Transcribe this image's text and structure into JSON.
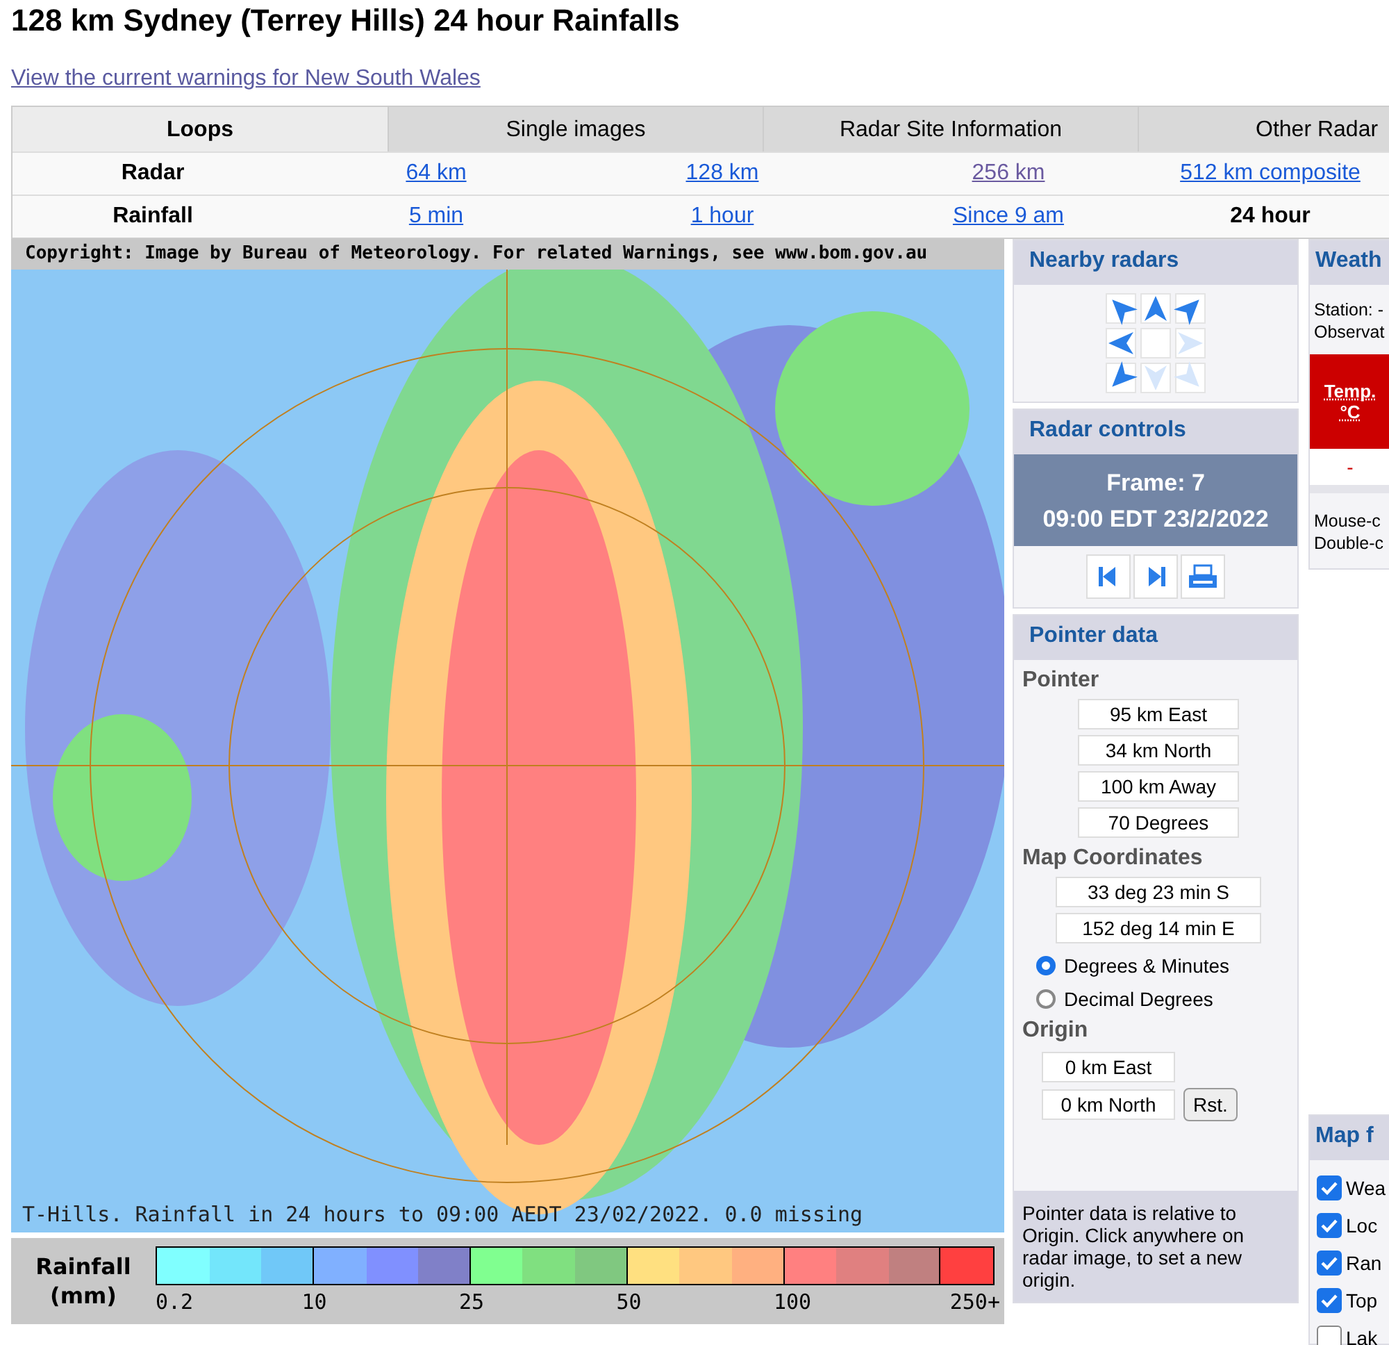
{
  "page_title": "128 km Sydney (Terrey Hills) 24 hour Rainfalls",
  "warnings_link": "View the current warnings for New South Wales",
  "tabs": [
    {
      "label": "Loops",
      "selected": true
    },
    {
      "label": "Single images",
      "selected": false
    },
    {
      "label": "Radar Site Information",
      "selected": false
    },
    {
      "label": "Other Radar",
      "selected": false
    }
  ],
  "product_rows": [
    {
      "label": "Radar",
      "links": [
        {
          "text": "64 km",
          "visited": false,
          "current": false
        },
        {
          "text": "128 km",
          "visited": false,
          "current": false
        },
        {
          "text": "256 km",
          "visited": true,
          "current": false
        },
        {
          "text": "512 km composite",
          "visited": false,
          "current": false
        }
      ]
    },
    {
      "label": "Rainfall",
      "links": [
        {
          "text": "5 min",
          "visited": false,
          "current": false
        },
        {
          "text": "1 hour",
          "visited": false,
          "current": false
        },
        {
          "text": "Since 9 am",
          "visited": false,
          "current": false
        },
        {
          "text": "24 hour",
          "visited": false,
          "current": true
        }
      ]
    }
  ],
  "radar_image": {
    "copyright": "Copyright: Image by Bureau of Meteorology. For related Warnings, see www.bom.gov.au",
    "caption": "T-Hills. Rainfall in 24 hours to 09:00 AEDT 23/02/2022. 0.0 missing"
  },
  "legend": {
    "title": "Rainfall",
    "unit": "(mm)",
    "swatches": [
      {
        "color": "#80ffff"
      },
      {
        "color": "#73e6fb"
      },
      {
        "color": "#70c8f8"
      },
      {
        "color": "#80b0ff"
      },
      {
        "color": "#8090ff"
      },
      {
        "color": "#8080c8"
      },
      {
        "color": "#80ff90"
      },
      {
        "color": "#80e080"
      },
      {
        "color": "#80c880"
      },
      {
        "color": "#ffe080"
      },
      {
        "color": "#ffc880"
      },
      {
        "color": "#ffb080"
      },
      {
        "color": "#ff8080"
      },
      {
        "color": "#e08080"
      },
      {
        "color": "#c08080"
      },
      {
        "color": "#ff4040"
      }
    ],
    "ticks": [
      "0.2",
      "10",
      "25",
      "50",
      "100",
      "250+"
    ]
  },
  "nearby_radars": {
    "title": "Nearby radars",
    "arrows": [
      {
        "kind": "nw",
        "disabled": false
      },
      {
        "kind": "n",
        "disabled": false
      },
      {
        "kind": "ne",
        "disabled": false
      },
      {
        "kind": "w",
        "disabled": false
      },
      {
        "kind": "e",
        "disabled": true
      },
      {
        "kind": "sw",
        "disabled": false
      },
      {
        "kind": "s",
        "disabled": true
      },
      {
        "kind": "se",
        "disabled": true
      }
    ]
  },
  "radar_controls": {
    "title": "Radar controls",
    "frame": "Frame: 7",
    "time": "09:00 EDT 23/2/2022",
    "buttons": [
      {
        "kind": "back"
      },
      {
        "kind": "forward"
      },
      {
        "kind": "print"
      }
    ]
  },
  "pointer_data": {
    "title": "Pointer data",
    "pointer_heading": "Pointer",
    "pointer_values": [
      "95 km East",
      "34 km North",
      "100 km Away",
      "70 Degrees"
    ],
    "coords_heading": "Map Coordinates",
    "coords_values": [
      "33 deg 23 min S",
      "152 deg 14 min E"
    ],
    "formats": [
      {
        "label": "Degrees & Minutes",
        "selected": true
      },
      {
        "label": "Decimal Degrees",
        "selected": false
      }
    ],
    "origin_heading": "Origin",
    "origin_values": [
      "0 km East",
      "0 km North"
    ],
    "reset_button": "Rst.",
    "note": "Pointer data is relative to Origin. Click anywhere on radar image, to set a new origin."
  },
  "weather": {
    "title": "Weath",
    "station": "Station: -",
    "observation": "Observat",
    "temp_label": "Temp.",
    "temp_unit": "°C",
    "temp_value": "-",
    "hint_lines": [
      "Mouse-c",
      "Double-c"
    ]
  },
  "map_features": {
    "title": "Map f",
    "items": [
      {
        "label": "Wea",
        "checked": true
      },
      {
        "label": "Loc",
        "checked": true
      },
      {
        "label": "Ran",
        "checked": true
      },
      {
        "label": "Top",
        "checked": true
      },
      {
        "label": "Lak",
        "checked": false
      }
    ]
  }
}
